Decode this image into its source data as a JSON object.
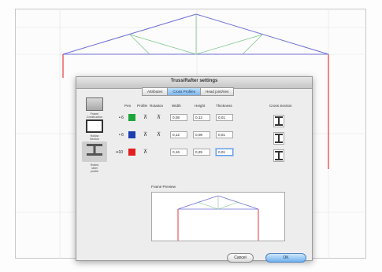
{
  "dialog": {
    "title": "Truss/Rafter settings",
    "tabs": [
      {
        "label": "Attributes",
        "active": false
      },
      {
        "label": "Cross Profiles",
        "active": true
      },
      {
        "label": "Head joint/ries",
        "active": false
      }
    ]
  },
  "left_panel": {
    "items": [
      {
        "label": "Frame\nConstruction",
        "icon": "frame-construction-icon",
        "selected": false
      },
      {
        "label": "Hollow\nSection",
        "icon": "hollow-section-icon",
        "selected": false
      },
      {
        "label": "Rolled\nsteel\nprofile",
        "icon": "rolled-steel-profile-icon",
        "selected": true
      }
    ]
  },
  "profiles_table": {
    "headers": {
      "pen": "Pen",
      "profile": "Profile",
      "rotation": "Rotation",
      "width": "Width",
      "height": "Height",
      "thickness": "Thickness",
      "cross_section": "Cross Section"
    },
    "rows": [
      {
        "bullet": "• 6",
        "pen_color": "#1fa53a",
        "profile_icon": "profile-icon",
        "rotation_icon": "rotation-icon",
        "width": "0,08",
        "height": "0,12",
        "thickness": "0,01",
        "section_icon": "i-beam-icon"
      },
      {
        "bullet": "• 6",
        "pen_color": "#1b3fb0",
        "profile_icon": "profile-icon",
        "rotation_icon": "rotation-icon",
        "width": "0,12",
        "height": "0,08",
        "thickness": "0,01",
        "section_icon": "i-beam-icon"
      },
      {
        "bullet": "••10",
        "pen_color": "#e01f1f",
        "profile_icon": "profile-icon",
        "rotation_icon": "",
        "width": "0,16",
        "height": "0,25",
        "thickness": "0,01",
        "section_icon": "i-beam-icon"
      }
    ]
  },
  "preview": {
    "label": "Frame Preview"
  },
  "buttons": {
    "cancel": "Cancel",
    "ok": "OK"
  },
  "colors": {
    "rafter_blue": "#6f6fd6",
    "rafter_green": "#7cc78c",
    "post_red": "#e43a3a"
  }
}
